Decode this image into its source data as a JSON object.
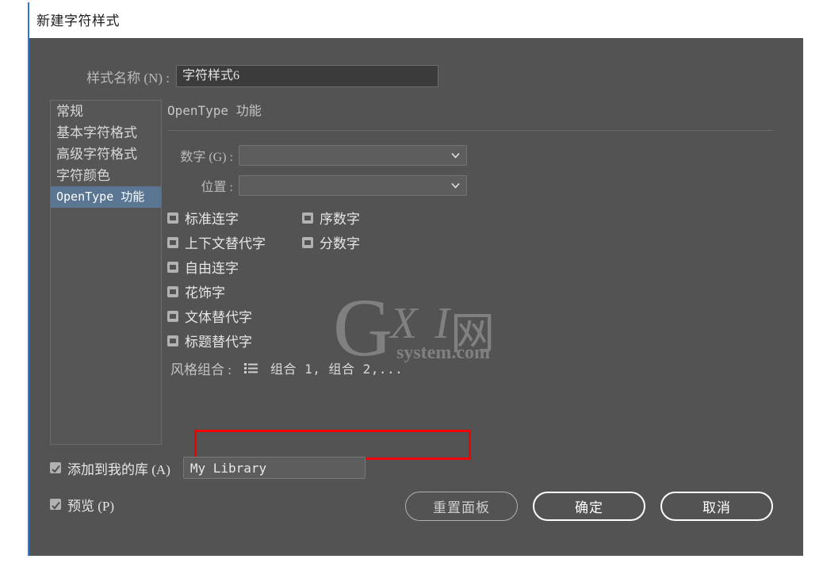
{
  "window": {
    "title": "新建字符样式",
    "accent_color": "#2a7ad4",
    "panel_bg": "#535353"
  },
  "style_name": {
    "label": "样式名称 (N) :",
    "value": "字符样式6",
    "placeholder": ""
  },
  "sidebar": {
    "items": [
      {
        "label": "常规",
        "selected": false
      },
      {
        "label": "基本字符格式",
        "selected": false
      },
      {
        "label": "高级字符格式",
        "selected": false
      },
      {
        "label": "字符颜色",
        "selected": false
      },
      {
        "label": "OpenType 功能",
        "selected": true
      }
    ],
    "selected_color": "#5b7693"
  },
  "main": {
    "section_title": "OpenType 功能",
    "dropdowns": [
      {
        "label": "数字 (G) :",
        "value": "",
        "icon": "chevron-down-icon"
      },
      {
        "label": "位置 :",
        "value": "",
        "icon": "chevron-down-icon"
      }
    ],
    "checkboxes": [
      {
        "label": "标准连字",
        "state": "mixed"
      },
      {
        "label": "序数字",
        "state": "mixed"
      },
      {
        "label": "上下文替代字",
        "state": "mixed"
      },
      {
        "label": "分数字",
        "state": "mixed"
      },
      {
        "label": "自由连字",
        "state": "mixed"
      },
      {
        "label": "花饰字",
        "state": "mixed"
      },
      {
        "label": "文体替代字",
        "state": "mixed"
      },
      {
        "label": "标题替代字",
        "state": "mixed"
      }
    ],
    "stylistic_sets": {
      "label": "风格组合 :",
      "icon": "list-bullet-icon",
      "value": "组合 1, 组合 2,...",
      "highlight_color": "#f50000"
    }
  },
  "footer": {
    "add_to_library": {
      "label": "添加到我的库 (A)",
      "checked": true
    },
    "library_select": {
      "value": "My Library",
      "icon": "chevron-down-icon"
    },
    "preview": {
      "label": "预览 (P)",
      "checked": true
    },
    "buttons": [
      {
        "label": "重置面板",
        "kind": "secondary"
      },
      {
        "label": "确定",
        "kind": "primary"
      },
      {
        "label": "取消",
        "kind": "cancel"
      }
    ]
  },
  "watermark": {
    "letter": "G",
    "mid": "X I",
    "net": "网",
    "domain": "system.com"
  }
}
